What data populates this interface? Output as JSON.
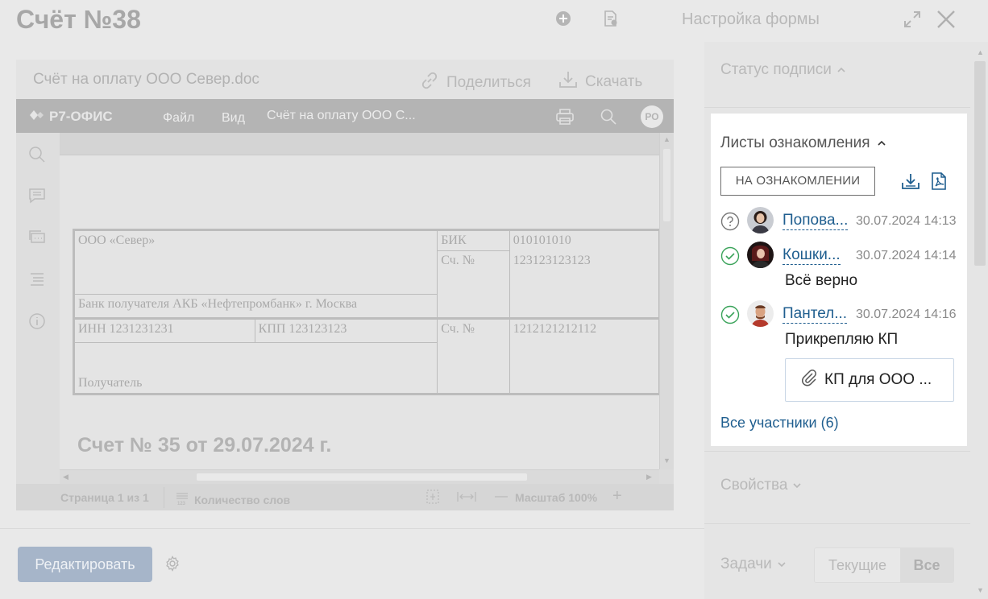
{
  "header": {
    "title": "Счёт №38",
    "form_setup": "Настройка формы",
    "icons": [
      "plus-circle-icon",
      "doc-settings-icon",
      "maximize-icon",
      "close-icon"
    ]
  },
  "viewer": {
    "file_name": "Счёт на оплату ООО Север.doc",
    "share_label": "Поделиться",
    "download_label": "Скачать",
    "editor": {
      "logo": "Р7-ОФИС",
      "menu_file": "Файл",
      "menu_view": "Вид",
      "doc_title": "Счёт на оплату ООО С...",
      "avatar": "РО"
    },
    "document": {
      "cells": {
        "org": "ООО «Север»",
        "bik_label": "БИК",
        "bik_value": "010101010",
        "acc_label": "Сч. №",
        "acc_value": "123123123123",
        "bank": "Банк получателя АКБ «Нефтепромбанк» г. Москва",
        "inn": "ИНН 1231231231",
        "kpp": "КПП 123123123",
        "acc2_label": "Сч. №",
        "acc2_value": "1212121212112",
        "recipient": "Получатель"
      },
      "invoice_title": "Счет № 35 от 29.07.2024 г."
    },
    "statusbar": {
      "page": "Страница 1 из 1",
      "word_count": "Количество слов",
      "zoom": "Масштаб 100%",
      "zoom_minus": "—",
      "zoom_plus": "+"
    }
  },
  "footer": {
    "edit_label": "Редактировать"
  },
  "right_panel": {
    "signature_status": "Статус подписи",
    "review_lists": {
      "title": "Листы ознакомления",
      "status_button": "НА ОЗНАКОМЛЕНИИ",
      "entries": [
        {
          "name": "Попова...",
          "date": "30.07.2024 14:13",
          "status": "pending",
          "comment": ""
        },
        {
          "name": "Кошки...",
          "date": "30.07.2024 14:14",
          "status": "done",
          "comment": "Всё верно"
        },
        {
          "name": "Пантел...",
          "date": "30.07.2024 14:16",
          "status": "done",
          "comment": "Прикрепляю КП"
        }
      ],
      "attachment": "КП для ООО ...",
      "all_participants": "Все участники (6)"
    },
    "properties": "Свойства",
    "tasks": {
      "title": "Задачи",
      "tab_current": "Текущие",
      "tab_all": "Все"
    }
  },
  "colors": {
    "link": "#1f5e8f",
    "success": "#3aa35a",
    "edit_button": "#a6b5c9"
  }
}
